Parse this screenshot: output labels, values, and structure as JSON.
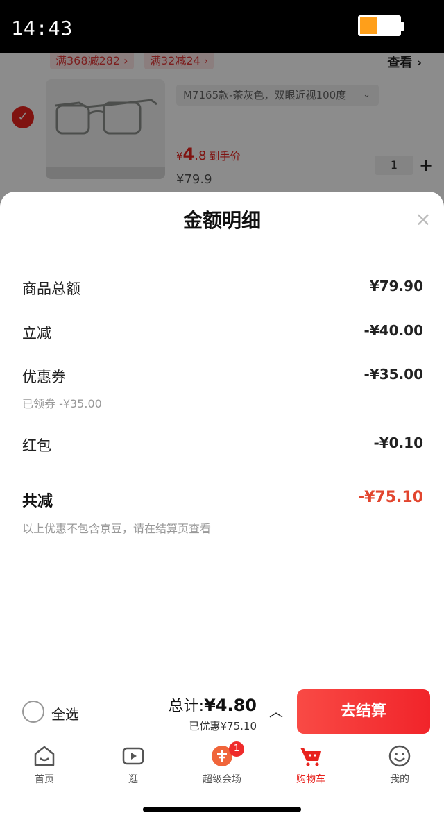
{
  "status_bar": {
    "time": "14:43",
    "battery_level": 0.42
  },
  "cart_background": {
    "promos": [
      "满368减282 ›",
      "满32减24 ›"
    ],
    "view_link": "查看 ›",
    "item": {
      "sku": "M7165款-茶灰色，双眼近视100度",
      "price_prefix": "¥",
      "price_int": "4",
      "price_dec": ".8",
      "price_label": "到手价",
      "original_price": "¥79.9",
      "quantity": "1"
    }
  },
  "sheet": {
    "title": "金额明细",
    "rows": [
      {
        "label": "商品总额",
        "value": "¥79.90"
      },
      {
        "label": "立减",
        "value": "-¥40.00"
      },
      {
        "label": "优惠券",
        "value": "-¥35.00",
        "sub": "已领券 -¥35.00"
      },
      {
        "label": "红包",
        "value": "-¥0.10"
      }
    ],
    "total": {
      "label": "共减",
      "value": "-¥75.10"
    },
    "note": "以上优惠不包含京豆，请在结算页查看"
  },
  "checkout": {
    "select_all": "全选",
    "total_prefix": "总计:",
    "total_amount": "¥4.80",
    "saved": "已优惠¥75.10",
    "button": "去结算"
  },
  "tabs": [
    {
      "label": "首页",
      "icon": "home-icon"
    },
    {
      "label": "逛",
      "icon": "video-play-icon"
    },
    {
      "label": "超级会场",
      "icon": "savings-icon",
      "badge": "1"
    },
    {
      "label": "购物车",
      "icon": "cart-icon",
      "active": true
    },
    {
      "label": "我的",
      "icon": "smiley-icon"
    }
  ],
  "colors": {
    "brand_red": "#e8231e",
    "discount_red": "#e2452e"
  }
}
